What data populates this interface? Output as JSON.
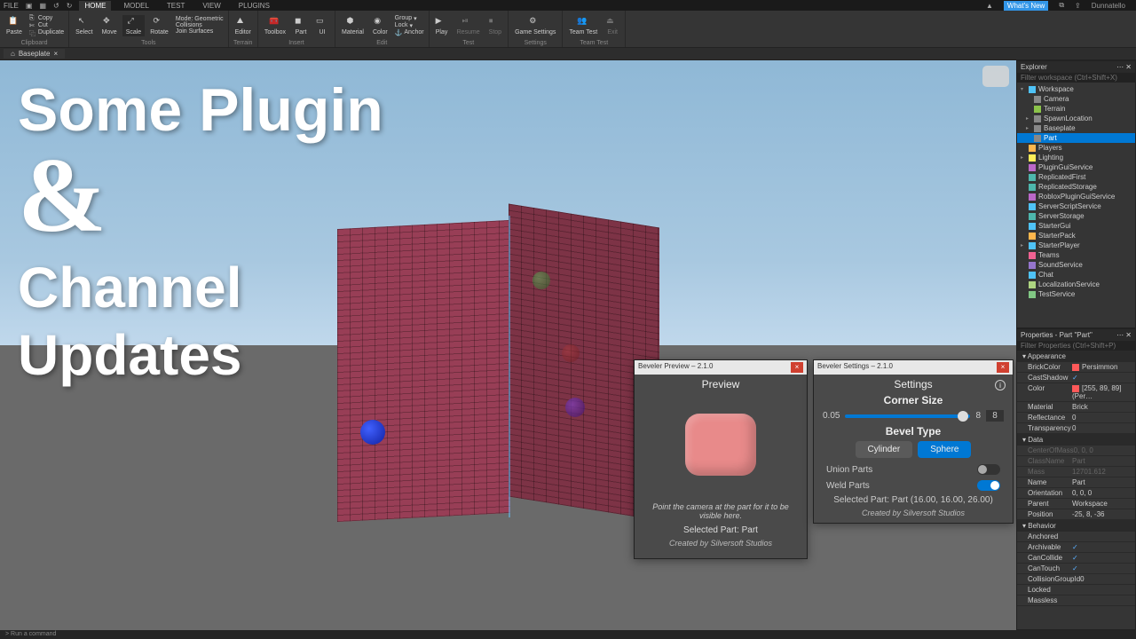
{
  "menubar": {
    "items": [
      "FILE"
    ],
    "username": "Dunnatello",
    "whats_new": "What's New"
  },
  "tabs": [
    "HOME",
    "MODEL",
    "TEST",
    "VIEW",
    "PLUGINS"
  ],
  "active_tab": "HOME",
  "ribbon": {
    "clipboard": {
      "copy": "Copy",
      "cut": "Cut",
      "duplicate": "Duplicate",
      "paste": "Paste",
      "label": "Clipboard"
    },
    "tools": {
      "select": "Select",
      "move": "Move",
      "scale": "Scale",
      "rotate": "Rotate",
      "mode": "Mode:",
      "mode_val": "Geometric",
      "collisions": "Collisions",
      "join": "Join Surfaces",
      "label": "Tools"
    },
    "terrain": {
      "editor": "Editor",
      "label": "Terrain"
    },
    "insert": {
      "toolbox": "Toolbox",
      "part": "Part",
      "ui": "UI",
      "label": "Insert"
    },
    "edit": {
      "material": "Material",
      "color": "Color",
      "group": "Group",
      "lock": "Lock",
      "anchor": "Anchor",
      "label": "Edit"
    },
    "test": {
      "play": "Play",
      "resume": "Resume",
      "stop": "Stop",
      "label": "Test"
    },
    "settings": {
      "game": "Game Settings",
      "label": "Settings"
    },
    "teamtest": {
      "team": "Team Test",
      "exit": "Exit",
      "label": "Team Test"
    }
  },
  "doc_tab": "Baseplate",
  "title_overlay": {
    "l1": "Some Plugin",
    "amp": "&",
    "l2": "Channel",
    "l3": "Updates"
  },
  "explorer": {
    "title": "Explorer",
    "filter_ph": "Filter workspace (Ctrl+Shift+X)",
    "tree": [
      {
        "n": "Workspace",
        "l": 0,
        "c": "#4fc3f7",
        "exp": true
      },
      {
        "n": "Camera",
        "l": 1,
        "c": "#888"
      },
      {
        "n": "Terrain",
        "l": 1,
        "c": "#8bc34a"
      },
      {
        "n": "SpawnLocation",
        "l": 1,
        "c": "#888",
        "arr": true
      },
      {
        "n": "Baseplate",
        "l": 1,
        "c": "#888",
        "arr": true
      },
      {
        "n": "Part",
        "l": 1,
        "c": "#888",
        "sel": true
      },
      {
        "n": "Players",
        "l": 0,
        "c": "#ffb74d"
      },
      {
        "n": "Lighting",
        "l": 0,
        "c": "#ffee58",
        "arr": true
      },
      {
        "n": "PluginGuiService",
        "l": 0,
        "c": "#ba68c8"
      },
      {
        "n": "ReplicatedFirst",
        "l": 0,
        "c": "#4db6ac"
      },
      {
        "n": "ReplicatedStorage",
        "l": 0,
        "c": "#4db6ac"
      },
      {
        "n": "RobloxPluginGuiService",
        "l": 0,
        "c": "#ba68c8"
      },
      {
        "n": "ServerScriptService",
        "l": 0,
        "c": "#4fc3f7"
      },
      {
        "n": "ServerStorage",
        "l": 0,
        "c": "#4db6ac"
      },
      {
        "n": "StarterGui",
        "l": 0,
        "c": "#4fc3f7"
      },
      {
        "n": "StarterPack",
        "l": 0,
        "c": "#ffb74d"
      },
      {
        "n": "StarterPlayer",
        "l": 0,
        "c": "#4fc3f7",
        "arr": true
      },
      {
        "n": "Teams",
        "l": 0,
        "c": "#f06292"
      },
      {
        "n": "SoundService",
        "l": 0,
        "c": "#9575cd"
      },
      {
        "n": "Chat",
        "l": 0,
        "c": "#4fc3f7"
      },
      {
        "n": "LocalizationService",
        "l": 0,
        "c": "#aed581"
      },
      {
        "n": "TestService",
        "l": 0,
        "c": "#81c784"
      }
    ]
  },
  "properties": {
    "title": "Properties - Part \"Part\"",
    "filter_ph": "Filter Properties (Ctrl+Shift+P)",
    "sections": [
      {
        "name": "Appearance",
        "rows": [
          {
            "k": "BrickColor",
            "v": "Persimmon",
            "sw": "#ff5959"
          },
          {
            "k": "CastShadow",
            "v": "✓",
            "chk": true
          },
          {
            "k": "Color",
            "v": "[255, 89, 89] (Per…",
            "sw": "#ff5959"
          },
          {
            "k": "Material",
            "v": "Brick"
          },
          {
            "k": "Reflectance",
            "v": "0"
          },
          {
            "k": "Transparency",
            "v": "0"
          }
        ]
      },
      {
        "name": "Data",
        "rows": [
          {
            "k": "CenterOfMass",
            "v": "0, 0, 0",
            "dis": true
          },
          {
            "k": "ClassName",
            "v": "Part",
            "dis": true
          },
          {
            "k": "Mass",
            "v": "12701.612",
            "dis": true
          },
          {
            "k": "Name",
            "v": "Part"
          },
          {
            "k": "Orientation",
            "v": "0, 0, 0"
          },
          {
            "k": "Parent",
            "v": "Workspace"
          },
          {
            "k": "Position",
            "v": "-25, 8, -36"
          }
        ]
      },
      {
        "name": "Behavior",
        "rows": [
          {
            "k": "Anchored",
            "v": ""
          },
          {
            "k": "Archivable",
            "v": "✓",
            "chk": true
          },
          {
            "k": "CanCollide",
            "v": "✓",
            "chk": true
          },
          {
            "k": "CanTouch",
            "v": "✓",
            "chk": true
          },
          {
            "k": "CollisionGroupId",
            "v": "0"
          },
          {
            "k": "Locked",
            "v": ""
          },
          {
            "k": "Massless",
            "v": ""
          }
        ]
      }
    ]
  },
  "preview_win": {
    "title": "Beveler Preview – 2.1.0",
    "heading": "Preview",
    "hint": "Point the camera at the part for it to be visible here.",
    "selected": "Selected Part: Part",
    "credit": "Created by Silversoft Studios"
  },
  "settings_win": {
    "title": "Beveler Settings – 2.1.0",
    "heading": "Settings",
    "corner_size": "Corner Size",
    "min": "0.05",
    "max": "8",
    "val": "8",
    "bevel_type": "Bevel Type",
    "cylinder": "Cylinder",
    "sphere": "Sphere",
    "union": "Union Parts",
    "weld": "Weld Parts",
    "selected": "Selected Part: Part (16.00, 16.00, 26.00)",
    "credit": "Created by Silversoft Studios"
  },
  "cmdbar": "Run a command"
}
